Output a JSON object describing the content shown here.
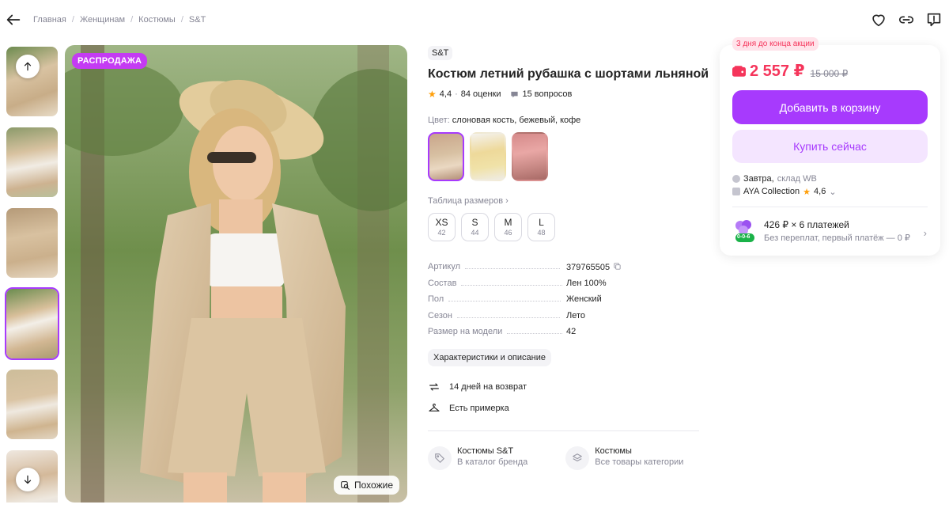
{
  "breadcrumb": [
    "Главная",
    "Женщинам",
    "Костюмы",
    "S&T"
  ],
  "main_photo": {
    "badge": "РАСПРОДАЖА",
    "similar_label": "Похожие"
  },
  "product": {
    "brand": "S&T",
    "title": "Костюм летний рубашка с шортами льняной",
    "rating": "4,4",
    "reviews": "84 оценки",
    "questions": "15 вопросов",
    "color_label": "Цвет:",
    "color_value": "слоновая кость, бежевый, кофе",
    "size_table_label": "Таблица размеров ›",
    "sizes": [
      {
        "label": "XS",
        "ru": "42"
      },
      {
        "label": "S",
        "ru": "44"
      },
      {
        "label": "M",
        "ru": "46"
      },
      {
        "label": "L",
        "ru": "48"
      }
    ],
    "specs": [
      {
        "key": "Артикул",
        "value": "379765505"
      },
      {
        "key": "Состав",
        "value": "Лен 100%"
      },
      {
        "key": "Пол",
        "value": "Женский"
      },
      {
        "key": "Сезон",
        "value": "Лето"
      },
      {
        "key": "Размер на модели",
        "value": "42"
      }
    ],
    "chars_button": "Характеристики и описание",
    "features": [
      "14 дней на возврат",
      "Есть примерка"
    ],
    "links": [
      {
        "title": "Костюмы S&T",
        "sub": "В каталог бренда"
      },
      {
        "title": "Костюмы",
        "sub": "Все товары категории"
      }
    ]
  },
  "buy": {
    "promo": "3 дня до конца акции",
    "price": "2 557 ₽",
    "old_price": "15 000 ₽",
    "cart_button": "Добавить в корзину",
    "buy_now_button": "Купить сейчас",
    "delivery_day": "Завтра,",
    "delivery_where": "склад WB",
    "seller": "AYA Collection",
    "seller_rating": "4,6",
    "installment_title": "426 ₽ × 6 платежей",
    "installment_sub": "Без переплат, первый платёж — 0 ₽",
    "installment_badge": "0-0-6"
  },
  "colors": {
    "accent": "#a73afd",
    "price": "#f5355b",
    "badge": "#c43bf3",
    "star": "#ff9f0a"
  }
}
